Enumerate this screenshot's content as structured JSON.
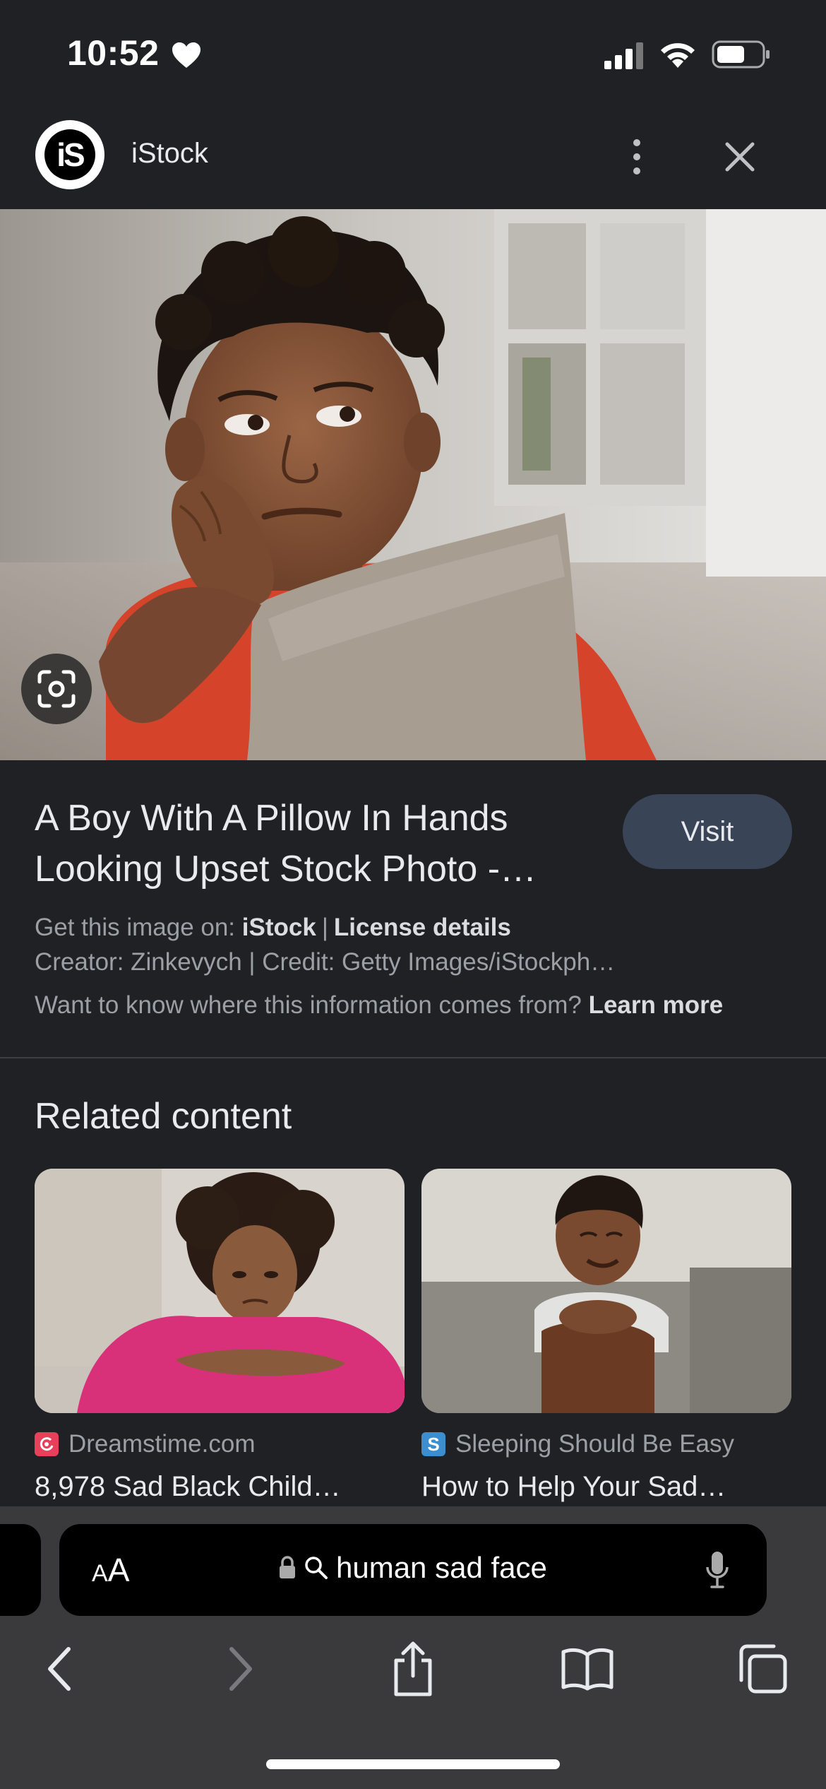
{
  "status_bar": {
    "time": "10:52"
  },
  "header": {
    "site_logo_text": "iS",
    "site_name": "iStock"
  },
  "image": {
    "alt": "A boy with a pillow in hands looking upset"
  },
  "details": {
    "title": "A Boy With A Pillow In Hands Looking Upset Stock Photo -…",
    "visit_label": "Visit",
    "get_image_prefix": "Get this image on:",
    "get_image_source": "iStock",
    "license_label": "License details",
    "creator_line": "Creator: Zinkevych | Credit: Getty Images/iStockph…",
    "info_question": "Want to know where this information comes from?",
    "learn_more_label": "Learn more"
  },
  "related": {
    "heading": "Related content",
    "items": [
      {
        "source": "Dreamstime.com",
        "favicon_letter": "",
        "title": "8,978 Sad Black Child…"
      },
      {
        "source": "Sleeping Should Be Easy",
        "favicon_letter": "S",
        "title": "How to Help Your Sad…"
      }
    ]
  },
  "toolbar": {
    "reader_label_small": "A",
    "reader_label_large": "A",
    "url_text": "human sad face"
  },
  "colors": {
    "background": "#202124",
    "visit_button": "#394457",
    "toolbar": "#3a3a3c"
  }
}
